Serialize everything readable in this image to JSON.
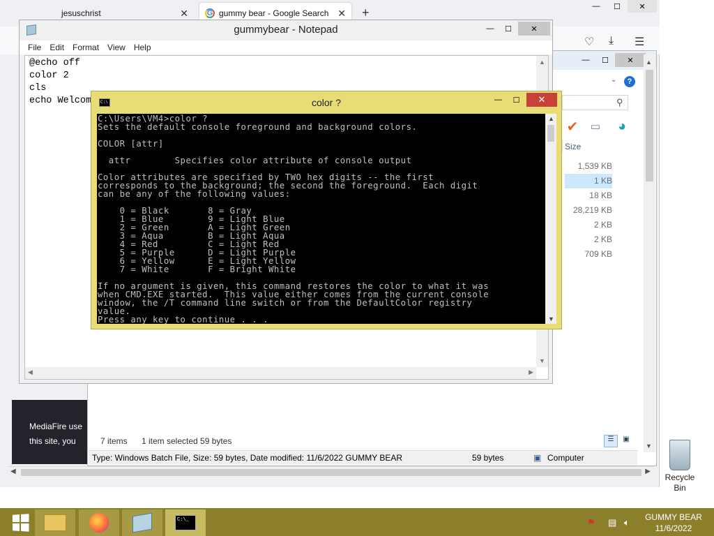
{
  "browser": {
    "tabs": [
      {
        "label": "jesuschrist",
        "close": "✕"
      },
      {
        "label": "gummy bear - Google Search",
        "close": "✕"
      }
    ],
    "new_tab": "+",
    "media_text": [
      "MediaFire use",
      "this site, you"
    ]
  },
  "explorer": {
    "help": "?",
    "size_header": "Size",
    "sizes": [
      "1,539 KB",
      "1 KB",
      "18 KB",
      "28,219 KB",
      "2 KB",
      "2 KB",
      "709 KB"
    ],
    "selected_index": 1,
    "status_items": "7 items",
    "status_selected": "1 item selected  59 bytes",
    "details_text": "Type: Windows Batch File, Size: 59 bytes, Date modified: 11/6/2022 GUMMY BEAR",
    "details_size": "59 bytes",
    "details_location": "Computer"
  },
  "notepad": {
    "title": "gummybear - Notepad",
    "menu": [
      "File",
      "Edit",
      "Format",
      "View",
      "Help"
    ],
    "lines": [
      "@echo off",
      "color 2",
      "cls",
      "echo Welcom"
    ]
  },
  "console": {
    "title": "color ?",
    "output": "C:\\Users\\VM4>color ?\nSets the default console foreground and background colors.\n\nCOLOR [attr]\n\n  attr        Specifies color attribute of console output\n\nColor attributes are specified by TWO hex digits -- the first\ncorresponds to the background; the second the foreground.  Each digit\ncan be any of the following values:\n\n    0 = Black       8 = Gray\n    1 = Blue        9 = Light Blue\n    2 = Green       A = Light Green\n    3 = Aqua        B = Light Aqua\n    4 = Red         C = Light Red\n    5 = Purple      D = Light Purple\n    6 = Yellow      E = Light Yellow\n    7 = White       F = Bright White\n\nIf no argument is given, this command restores the color to what it was\nwhen CMD.EXE started.  This value either comes from the current console\nwindow, the /T command line switch or from the DefaultColor registry\nvalue.\nPress any key to continue . . ."
  },
  "desktop": {
    "recycle_bin": "Recycle Bin"
  },
  "taskbar": {
    "clock_line1": "GUMMY BEAR",
    "clock_line2": "11/6/2022"
  },
  "colors": {
    "taskbar": "#8c7f2c",
    "console_frame": "#e7dc76",
    "close_red": "#c7413a"
  },
  "icons": [
    "windows-start-icon",
    "file-explorer-icon",
    "firefox-icon",
    "notepad-icon",
    "cmd-icon",
    "flag-icon",
    "network-icon",
    "volume-icon",
    "recycle-bin-icon",
    "google-icon",
    "pocket-icon",
    "download-icon",
    "menu-icon",
    "search-icon",
    "help-icon"
  ]
}
